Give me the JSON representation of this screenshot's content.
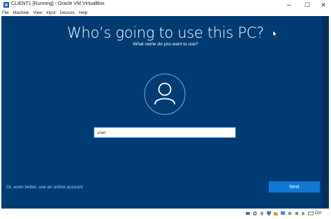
{
  "window": {
    "title": "CLIENT1 [Running] - Oracle VM VirtualBox",
    "minimize_glyph": "─",
    "maximize_glyph": "☐",
    "close_glyph": "✕"
  },
  "menubar": {
    "items": [
      "File",
      "Machine",
      "View",
      "Input",
      "Devices",
      "Help"
    ]
  },
  "oobe": {
    "heading": "Who’s going to use this PC?",
    "subheading": "What name do you want to use?",
    "name_value": "user",
    "online_account_link": "Or, even better, use an online account",
    "next_label": "Next"
  },
  "statusbar": {
    "icons": [
      "hard-disk-icon",
      "optical-drive-icon",
      "usb-icon",
      "network-icon",
      "shared-folder-icon",
      "display-icon",
      "recording-icon",
      "cpu-icon",
      "mouse-integration-icon",
      "keyboard-icon"
    ],
    "host_key": "Ctrl"
  },
  "colors": {
    "vm_background": "#003c74",
    "next_button": "#0f78d4",
    "link": "#9fd4ff"
  }
}
